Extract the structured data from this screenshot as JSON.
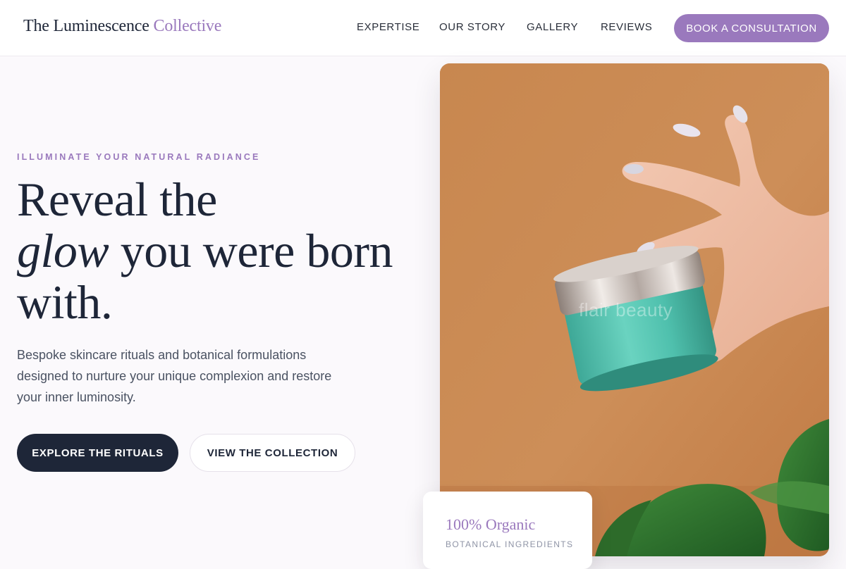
{
  "brand": {
    "name_primary": "The Luminescence",
    "name_accent": "Collective"
  },
  "nav": {
    "items": [
      {
        "label": "EXPERTISE"
      },
      {
        "label": "OUR STORY"
      },
      {
        "label": "GALLERY"
      },
      {
        "label": "REVIEWS"
      }
    ],
    "cta_label": "BOOK A CONSULTATION"
  },
  "hero": {
    "eyebrow": "ILLUMINATE YOUR NATURAL RADIANCE",
    "headline_line1": "Reveal the",
    "headline_italic": "glow",
    "headline_line2_rest": " you were born",
    "headline_line3": "with.",
    "subtext": "Bespoke skincare rituals and botanical formulations designed to nurture your unique complexion and restore your inner luminosity.",
    "primary_button": "EXPLORE THE RITUALS",
    "secondary_button": "VIEW THE COLLECTION",
    "image_watermark": "flair beauty"
  },
  "stat_card": {
    "title": "100% Organic",
    "subtitle": "BOTANICAL INGREDIENTS"
  },
  "colors": {
    "accent": "#9a79bd",
    "navy": "#1e2638",
    "image_background": "#c98850",
    "jar_teal": "#4fc0ad"
  }
}
